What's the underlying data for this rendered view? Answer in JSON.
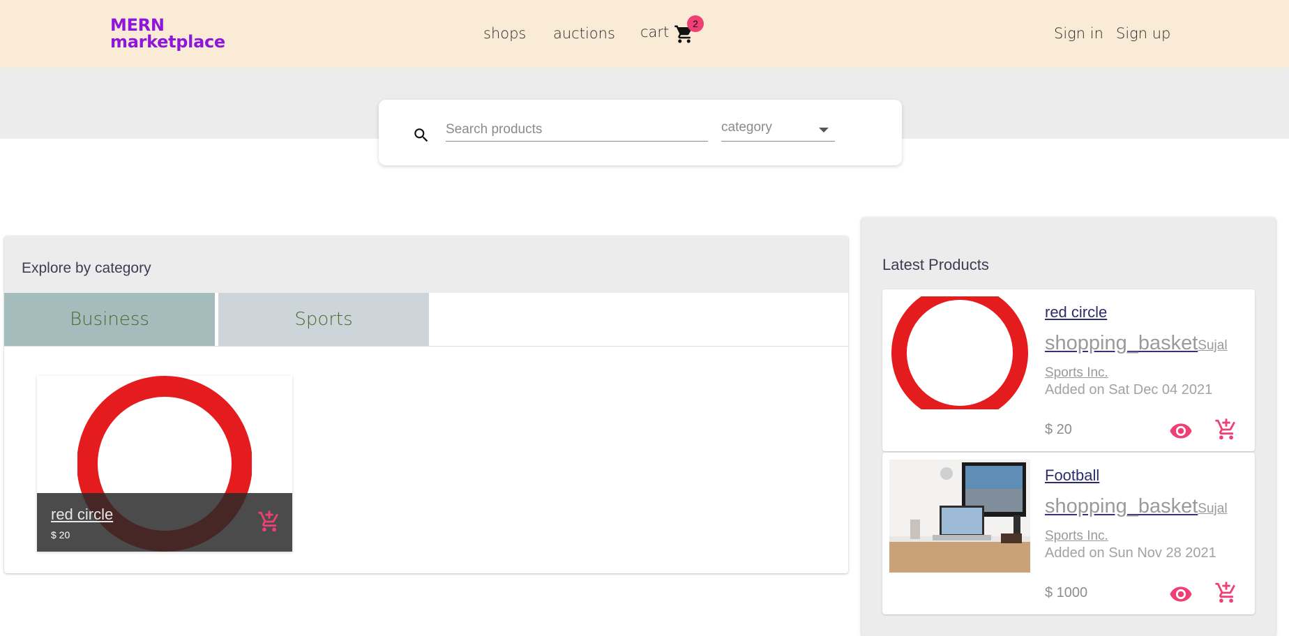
{
  "header": {
    "brand_line1": "MERN",
    "brand_line2": "marketplace",
    "nav": {
      "shops": "shops",
      "auctions": "auctions",
      "cart": "cart"
    },
    "cart_count": "2",
    "auth": {
      "signin": "Sign in",
      "signup": "Sign up"
    }
  },
  "search": {
    "placeholder": "Search products",
    "category_label": "category"
  },
  "explore": {
    "title": "Explore by category",
    "tabs": [
      {
        "label": "Business"
      },
      {
        "label": "Sports"
      }
    ],
    "items": [
      {
        "name": "red circle",
        "price": "$ 20"
      }
    ]
  },
  "latest": {
    "title": "Latest Products",
    "products": [
      {
        "name": "red circle",
        "shop_icon": "shopping_basket",
        "shop": "Sujal Sports Inc.",
        "added": "Added on Sat Dec 04 2021",
        "price": "$ 20"
      },
      {
        "name": "Football",
        "shop_icon": "shopping_basket",
        "shop": "Sujal Sports Inc.",
        "added": "Added on Sun Nov 28 2021",
        "price": "$ 1000"
      }
    ]
  },
  "colors": {
    "brand": "#8e16d8",
    "header_bg": "#f9ebd6",
    "accent": "#ef3f74",
    "tab_active": "#a4bcbb",
    "tab_inactive": "#cdd5da"
  },
  "icons": [
    "cart-icon",
    "search-icon",
    "chevron-down-icon",
    "add-shopping-cart-icon",
    "view-icon"
  ]
}
